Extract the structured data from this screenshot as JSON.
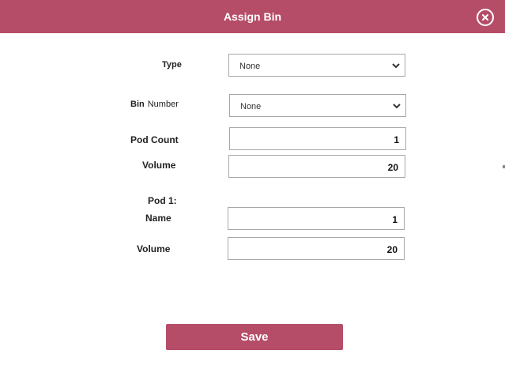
{
  "dialog": {
    "title": "Assign Bin",
    "close_icon": "close-circle-icon"
  },
  "form": {
    "type": {
      "label": "Type",
      "value": "None"
    },
    "bin_number": {
      "label_bold": "Bin",
      "label_normal": "Number",
      "value": "None"
    },
    "pod_count": {
      "label": "Pod Count",
      "value": "1"
    },
    "volume": {
      "label": "Volume",
      "value": "20"
    },
    "pod_section_title": "Pod 1:",
    "pod_name": {
      "label": "Name",
      "value": "1"
    },
    "pod_volume": {
      "label": "Volume",
      "value": "20"
    }
  },
  "footer": {
    "save_label": "Save"
  },
  "colors": {
    "accent": "#b64d68",
    "border": "#a8a8a8"
  }
}
